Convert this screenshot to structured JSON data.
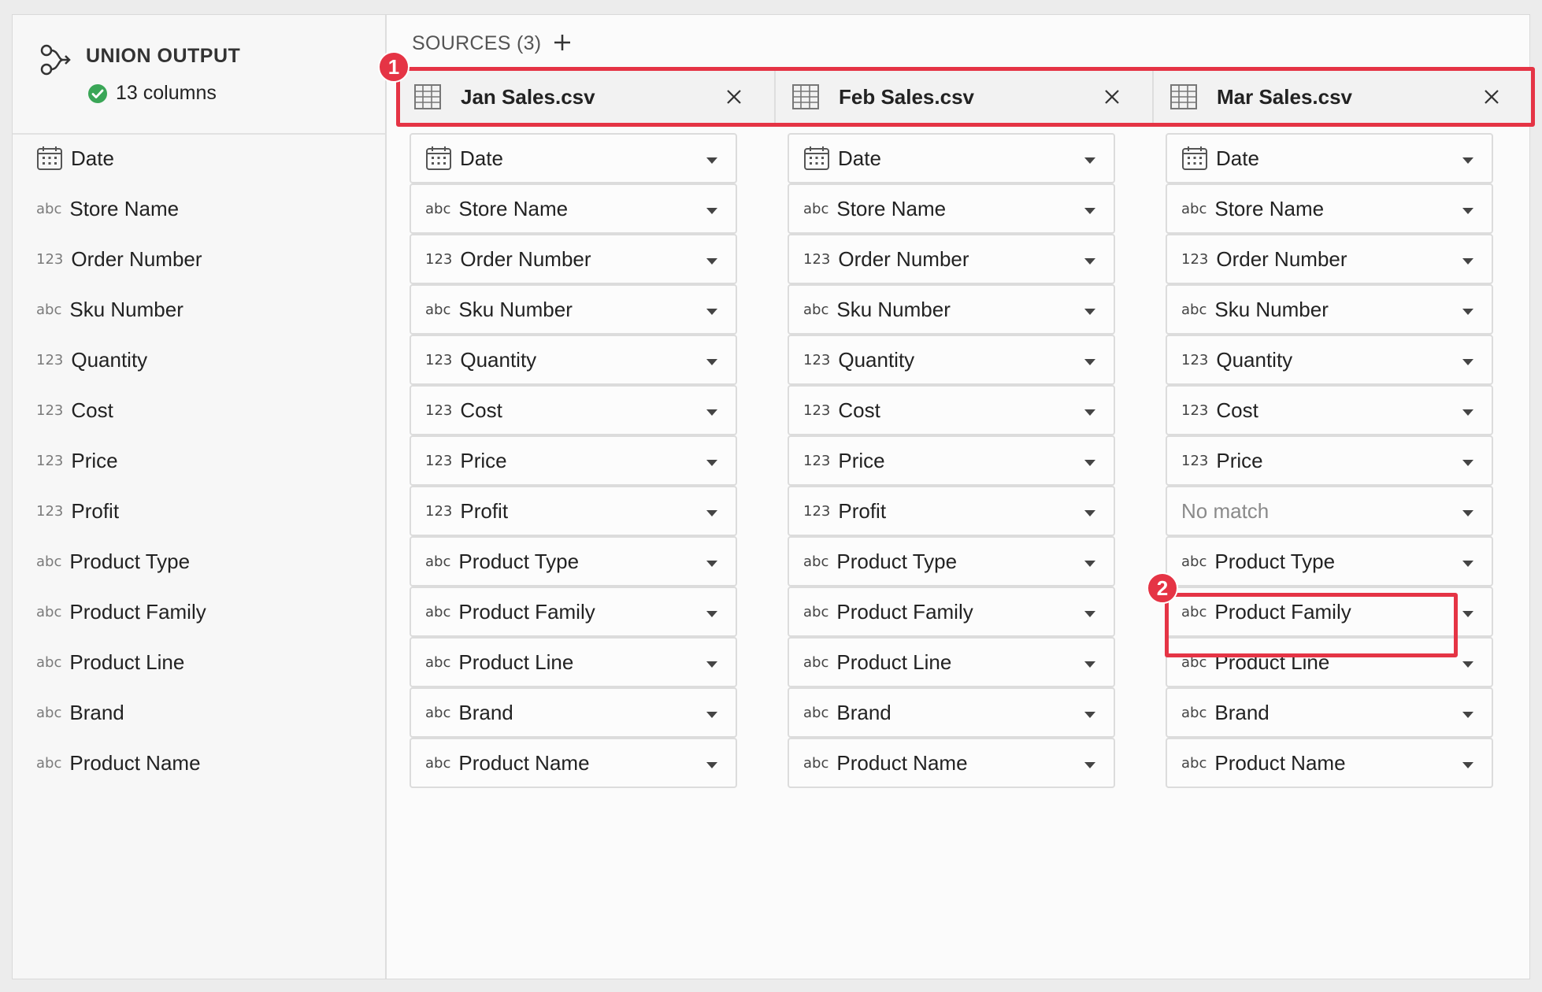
{
  "output": {
    "title": "UNION OUTPUT",
    "column_count_text": "13 columns",
    "status_color": "#3aa657",
    "columns": [
      {
        "type": "date",
        "label": "Date"
      },
      {
        "type": "abc",
        "label": "Store Name"
      },
      {
        "type": "123",
        "label": "Order Number"
      },
      {
        "type": "abc",
        "label": "Sku Number"
      },
      {
        "type": "123",
        "label": "Quantity"
      },
      {
        "type": "123",
        "label": "Cost"
      },
      {
        "type": "123",
        "label": "Price"
      },
      {
        "type": "123",
        "label": "Profit"
      },
      {
        "type": "abc",
        "label": "Product Type"
      },
      {
        "type": "abc",
        "label": "Product Family"
      },
      {
        "type": "abc",
        "label": "Product Line"
      },
      {
        "type": "abc",
        "label": "Brand"
      },
      {
        "type": "abc",
        "label": "Product Name"
      }
    ]
  },
  "sources": {
    "title": "SOURCES (3)",
    "add_icon": "plus-icon",
    "items": [
      {
        "name": "Jan Sales.csv",
        "mappings": [
          {
            "type": "date",
            "label": "Date"
          },
          {
            "type": "abc",
            "label": "Store Name"
          },
          {
            "type": "123",
            "label": "Order Number"
          },
          {
            "type": "abc",
            "label": "Sku Number"
          },
          {
            "type": "123",
            "label": "Quantity"
          },
          {
            "type": "123",
            "label": "Cost"
          },
          {
            "type": "123",
            "label": "Price"
          },
          {
            "type": "123",
            "label": "Profit"
          },
          {
            "type": "abc",
            "label": "Product Type"
          },
          {
            "type": "abc",
            "label": "Product Family"
          },
          {
            "type": "abc",
            "label": "Product Line"
          },
          {
            "type": "abc",
            "label": "Brand"
          },
          {
            "type": "abc",
            "label": "Product Name"
          }
        ]
      },
      {
        "name": "Feb Sales.csv",
        "mappings": [
          {
            "type": "date",
            "label": "Date"
          },
          {
            "type": "abc",
            "label": "Store Name"
          },
          {
            "type": "123",
            "label": "Order Number"
          },
          {
            "type": "abc",
            "label": "Sku Number"
          },
          {
            "type": "123",
            "label": "Quantity"
          },
          {
            "type": "123",
            "label": "Cost"
          },
          {
            "type": "123",
            "label": "Price"
          },
          {
            "type": "123",
            "label": "Profit"
          },
          {
            "type": "abc",
            "label": "Product Type"
          },
          {
            "type": "abc",
            "label": "Product Family"
          },
          {
            "type": "abc",
            "label": "Product Line"
          },
          {
            "type": "abc",
            "label": "Brand"
          },
          {
            "type": "abc",
            "label": "Product Name"
          }
        ]
      },
      {
        "name": "Mar Sales.csv",
        "mappings": [
          {
            "type": "date",
            "label": "Date"
          },
          {
            "type": "abc",
            "label": "Store Name"
          },
          {
            "type": "123",
            "label": "Order Number"
          },
          {
            "type": "abc",
            "label": "Sku Number"
          },
          {
            "type": "123",
            "label": "Quantity"
          },
          {
            "type": "123",
            "label": "Cost"
          },
          {
            "type": "123",
            "label": "Price"
          },
          {
            "type": "none",
            "label": "No match"
          },
          {
            "type": "abc",
            "label": "Product Type"
          },
          {
            "type": "abc",
            "label": "Product Family"
          },
          {
            "type": "abc",
            "label": "Product Line"
          },
          {
            "type": "abc",
            "label": "Brand"
          },
          {
            "type": "abc",
            "label": "Product Name"
          }
        ]
      }
    ]
  },
  "annotations": [
    {
      "number": "1",
      "target": "source-tabs"
    },
    {
      "number": "2",
      "target": "no-match-dropdown"
    }
  ],
  "type_labels": {
    "abc": "abc",
    "123": "123"
  },
  "colors": {
    "highlight": "#e53445",
    "success": "#3aa657"
  }
}
